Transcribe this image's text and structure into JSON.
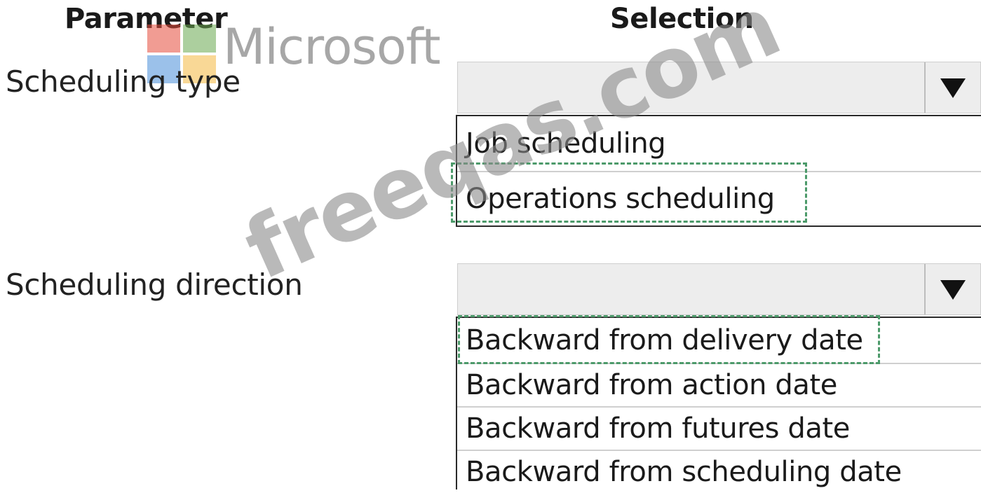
{
  "headers": {
    "parameter": "Parameter",
    "selection": "Selection"
  },
  "watermarks": {
    "logo_text": "Microsoft",
    "site": "freeqas.com"
  },
  "colors": {
    "logo_red": "#e74c3c",
    "logo_green": "#6aa84f",
    "logo_blue": "#4a90d9",
    "logo_yellow": "#f5b942",
    "selection_outline": "#4c9a6a"
  },
  "parameters": [
    {
      "label": "Scheduling type",
      "dropdown_value": "",
      "dropdown_icon": "triangle-down-icon",
      "options": [
        "Job scheduling",
        "Operations scheduling"
      ],
      "selected_option": "Operations scheduling"
    },
    {
      "label": "Scheduling direction",
      "dropdown_value": "",
      "dropdown_icon": "triangle-down-icon",
      "options": [
        "Backward from delivery date",
        "Backward from action date",
        "Backward from futures date",
        "Backward from scheduling date"
      ],
      "selected_option": "Backward from delivery date"
    }
  ]
}
